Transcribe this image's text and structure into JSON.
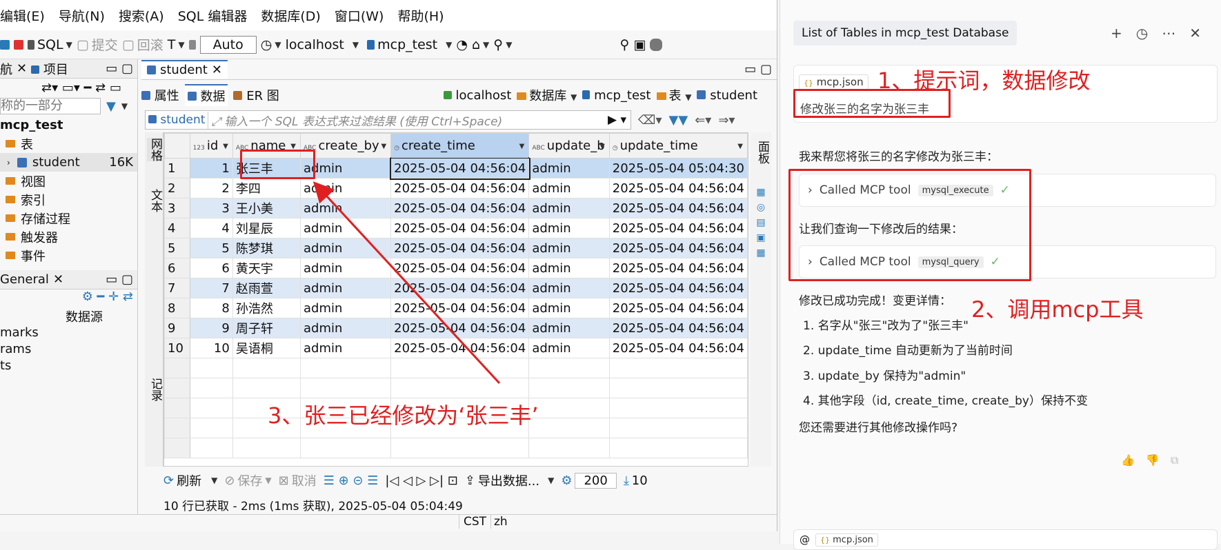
{
  "menu": [
    "编辑(E)",
    "导航(N)",
    "搜索(A)",
    "SQL 编辑器",
    "数据库(D)",
    "窗口(W)",
    "帮助(H)"
  ],
  "toolbar": {
    "sql": "SQL",
    "commit": "提交",
    "rollback": "回滚",
    "auto": "Auto",
    "host": "localhost",
    "db": "mcp_test"
  },
  "leftpanel": {
    "tab1": "航",
    "tab2": "项目",
    "filter_placeholder": "称的一部分",
    "db": "mcp_test",
    "table_group": "表",
    "table": "student",
    "table_size": "16K",
    "items": [
      "视图",
      "索引",
      "存储过程",
      "触发器",
      "事件"
    ],
    "general_tab": "General",
    "datasource": "数据源",
    "lines": [
      "marks",
      "rams",
      "ts"
    ]
  },
  "editor": {
    "tab": "student",
    "subtabs": [
      "属性",
      "数据",
      "ER 图"
    ],
    "crumbs": [
      "localhost",
      "数据库",
      "mcp_test",
      "表",
      "student"
    ],
    "filter_label": "student",
    "filter_placeholder": "输入一个 SQL 表达式来过滤结果 (使用 Ctrl+Space)"
  },
  "grid": {
    "columns": [
      "id",
      "name",
      "create_by",
      "create_time",
      "update_b",
      "update_time"
    ],
    "rows": [
      [
        "1",
        "1",
        "张三丰",
        "admin",
        "2025-05-04 04:56:04",
        "admin",
        "2025-05-04 05:04:30"
      ],
      [
        "2",
        "2",
        "李四",
        "admin",
        "2025-05-04 04:56:04",
        "admin",
        "2025-05-04 04:56:04"
      ],
      [
        "3",
        "3",
        "王小美",
        "admin",
        "2025-05-04 04:56:04",
        "admin",
        "2025-05-04 04:56:04"
      ],
      [
        "4",
        "4",
        "刘星辰",
        "admin",
        "2025-05-04 04:56:04",
        "admin",
        "2025-05-04 04:56:04"
      ],
      [
        "5",
        "5",
        "陈梦琪",
        "admin",
        "2025-05-04 04:56:04",
        "admin",
        "2025-05-04 04:56:04"
      ],
      [
        "6",
        "6",
        "黄天宇",
        "admin",
        "2025-05-04 04:56:04",
        "admin",
        "2025-05-04 04:56:04"
      ],
      [
        "7",
        "7",
        "赵雨萱",
        "admin",
        "2025-05-04 04:56:04",
        "admin",
        "2025-05-04 04:56:04"
      ],
      [
        "8",
        "8",
        "孙浩然",
        "admin",
        "2025-05-04 04:56:04",
        "admin",
        "2025-05-04 04:56:04"
      ],
      [
        "9",
        "9",
        "周子轩",
        "admin",
        "2025-05-04 04:56:04",
        "admin",
        "2025-05-04 04:56:04"
      ],
      [
        "10",
        "10",
        "吴语桐",
        "admin",
        "2025-05-04 04:56:04",
        "admin",
        "2025-05-04 04:56:04"
      ]
    ],
    "side_labels": [
      "网格",
      "文本",
      "记录"
    ],
    "right_label": "面板"
  },
  "bottom": {
    "refresh": "刷新",
    "save": "保存",
    "cancel": "取消",
    "export": "导出数据...",
    "limit": "200",
    "count": "10",
    "status": "10 行已获取 - 2ms (1ms 获取), 2025-05-04 05:04:49",
    "tz": "CST",
    "lang": "zh"
  },
  "chat": {
    "title": "List of Tables in mcp_test Database",
    "file_chip": "mcp.json",
    "prompt": "修改张三的名字为张三丰",
    "reply1": "我来帮您将张三的名字修改为张三丰：",
    "tool1": "Called MCP tool",
    "tool1_name": "mysql_execute",
    "reply2": "让我们查询一下修改后的结果：",
    "tool2": "Called MCP tool",
    "tool2_name": "mysql_query",
    "done": "修改已成功完成！变更详情：",
    "details": [
      "1. 名字从\"张三\"改为了\"张三丰\"",
      "2. update_time 自动更新为了当前时间",
      "3. update_by 保持为\"admin\"",
      "4. 其他字段（id, create_time, create_by）保持不变"
    ],
    "question": "您还需要进行其他修改操作吗?",
    "bottom_chip": "mcp.json"
  },
  "annotations": {
    "a1": "1、提示词，数据修改",
    "a2": "2、调用mcp工具",
    "a3": "3、张三已经修改为‘张三丰’",
    "color": "#e02020"
  }
}
